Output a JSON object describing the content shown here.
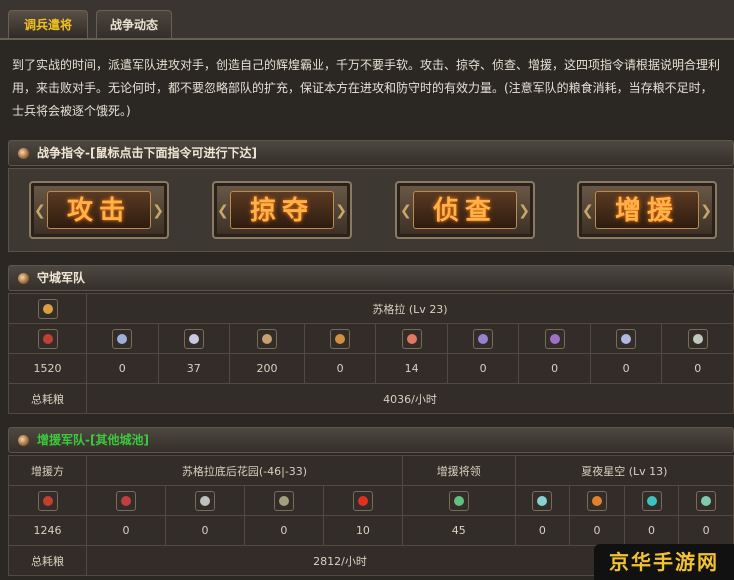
{
  "tabs": [
    {
      "label": "调兵遣将",
      "active": true
    },
    {
      "label": "战争动态",
      "active": false
    }
  ],
  "intro_text": "到了实战的时间，派遣军队进攻对手，创造自己的辉煌霸业，千万不要手软。攻击、掠夺、侦查、增援，这四项指令请根据说明合理利用，来击败对手。无论何时，都不要忽略部队的扩充，保证本方在进攻和防守时的有效力量。(注意军队的粮食消耗，当存粮不足时，士兵将会被逐个饿死。)",
  "war_commands": {
    "header": "战争指令-[鼠标点击下面指令可进行下达]",
    "buttons": [
      "攻击",
      "掠夺",
      "侦查",
      "增援"
    ]
  },
  "defense": {
    "header": "守城军队",
    "hero": "苏格拉 (Lv 23)",
    "unit_icons": [
      {
        "name": "sword-soldier-icon",
        "color": "#c04030"
      },
      {
        "name": "shield-knight-icon",
        "color": "#9fb0d8"
      },
      {
        "name": "spearman-icon",
        "color": "#c8c8e0"
      },
      {
        "name": "axe-soldier-icon",
        "color": "#c8a070"
      },
      {
        "name": "cavalry-icon",
        "color": "#d09040"
      },
      {
        "name": "war-beast-icon",
        "color": "#e07a60"
      },
      {
        "name": "mage-icon",
        "color": "#9a80d0"
      },
      {
        "name": "orb-icon",
        "color": "#a070c8"
      },
      {
        "name": "twin-orbs-icon",
        "color": "#b0b8e0"
      },
      {
        "name": "catapult-icon",
        "color": "#c0c8c0"
      }
    ],
    "counts": [
      "1520",
      "0",
      "37",
      "200",
      "0",
      "14",
      "0",
      "0",
      "0",
      "0"
    ],
    "total_label": "总耗粮",
    "total_value": "4036/小时"
  },
  "reinforce": {
    "header": "增援军队-[其他城池]",
    "from_label": "增援方",
    "from_value": "苏格拉底后花园(-46|-33)",
    "general_label": "增援将领",
    "general_value": "夏夜星空 (Lv 13)",
    "unit_icons": [
      {
        "name": "sword-soldier-icon",
        "color": "#c04030"
      },
      {
        "name": "dagger-icon",
        "color": "#c04040"
      },
      {
        "name": "archer-icon",
        "color": "#c0c0c0"
      },
      {
        "name": "axe-soldier-icon",
        "color": "#a0a080"
      },
      {
        "name": "berserker-icon",
        "color": "#e03020"
      },
      {
        "name": "green-warrior-icon",
        "color": "#60c080"
      },
      {
        "name": "mage-icon",
        "color": "#8ad0d0"
      },
      {
        "name": "fire-beast-icon",
        "color": "#e08030"
      },
      {
        "name": "cyan-orb-icon",
        "color": "#40c0c0"
      },
      {
        "name": "siege-icon",
        "color": "#80c8b0"
      }
    ],
    "counts": [
      "1246",
      "0",
      "0",
      "0",
      "10",
      "45",
      "0",
      "0",
      "0",
      "0"
    ],
    "total_label": "总耗粮",
    "total_value": "2812/小时"
  },
  "watermark": "京华手游网",
  "general_icon": "general-portrait-icon"
}
